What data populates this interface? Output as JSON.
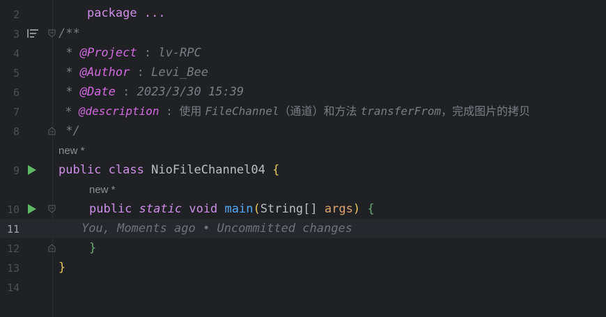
{
  "editor": {
    "top_fragment": "package ...",
    "lines": [
      {
        "number": "2"
      },
      {
        "number": "3",
        "text": "/**"
      },
      {
        "number": "4",
        "star": " * ",
        "tag": "@Project",
        "colon": " : ",
        "value": "lv-RPC"
      },
      {
        "number": "5",
        "star": " * ",
        "tag": "@Author",
        "colon": " : ",
        "value": "Levi_Bee"
      },
      {
        "number": "6",
        "star": " * ",
        "tag": "@Date",
        "colon": " : ",
        "value": "2023/3/30 15:39"
      },
      {
        "number": "7",
        "star": " * ",
        "tag": "@description",
        "colon": " : ",
        "value_cjk_1": "使用 ",
        "value_2": "FileChannel",
        "value_cjk_3": "（通道）和方法 ",
        "value_4": "transferFrom",
        "value_cjk_5": "，完成图片的拷贝"
      },
      {
        "number": "8",
        "text": " */"
      },
      {
        "number": "9",
        "kw1": "public",
        "kw2": "class",
        "class_name": "NioFileChannel04",
        "brace": "{"
      },
      {
        "number": "10",
        "kw1": "public",
        "kw2": "static",
        "kw3": "void",
        "method": "main",
        "lparen": "(",
        "type": "String[]",
        "param": "args",
        "rparen": ")",
        "brace": "{"
      },
      {
        "number": "11",
        "blame": "You, Moments ago • Uncommitted changes"
      },
      {
        "number": "12",
        "brace": "}"
      },
      {
        "number": "13",
        "brace": "}"
      },
      {
        "number": "14"
      }
    ],
    "usage_hints": {
      "class_hint": "new *",
      "method_hint": "new *"
    }
  },
  "colors": {
    "background": "#1f2125",
    "current_line": "#26282e",
    "keyword": "#cf8ee8",
    "method": "#56a8f5",
    "parameter": "#e0a56c",
    "doc_tag": "#d36ae0",
    "comment": "#7a7e85",
    "run_icon": "#5fb865"
  },
  "icons": {
    "run_class": "run-icon",
    "run_method": "run-icon",
    "fold": "fold-icon",
    "structure": "structure-icon"
  }
}
